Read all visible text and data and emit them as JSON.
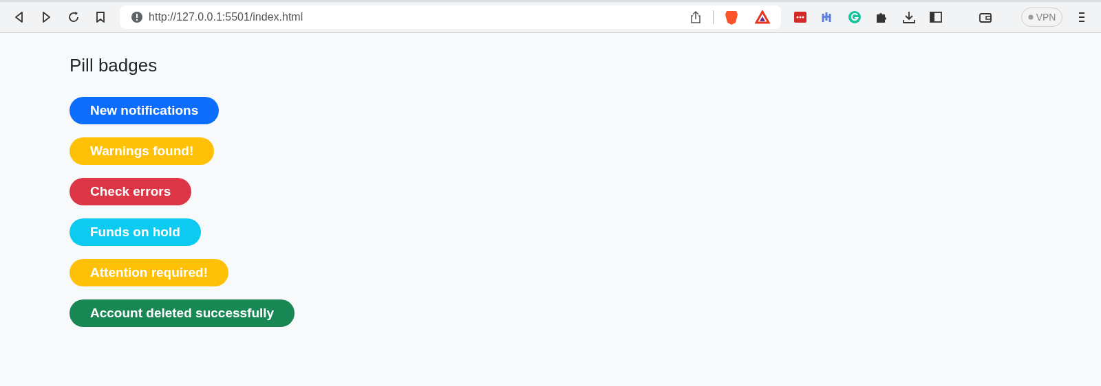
{
  "browser": {
    "url": "http://127.0.0.1:5501/index.html",
    "vpn_label": "VPN"
  },
  "heading": "Pill badges",
  "badges": [
    {
      "label": "New notifications",
      "color": "#0d6efd"
    },
    {
      "label": "Warnings found!",
      "color": "#ffc107"
    },
    {
      "label": "Check errors",
      "color": "#dc3545"
    },
    {
      "label": "Funds on hold",
      "color": "#0dcaf0"
    },
    {
      "label": "Attention required!",
      "color": "#ffc107"
    },
    {
      "label": "Account deleted successfully",
      "color": "#198754"
    }
  ]
}
